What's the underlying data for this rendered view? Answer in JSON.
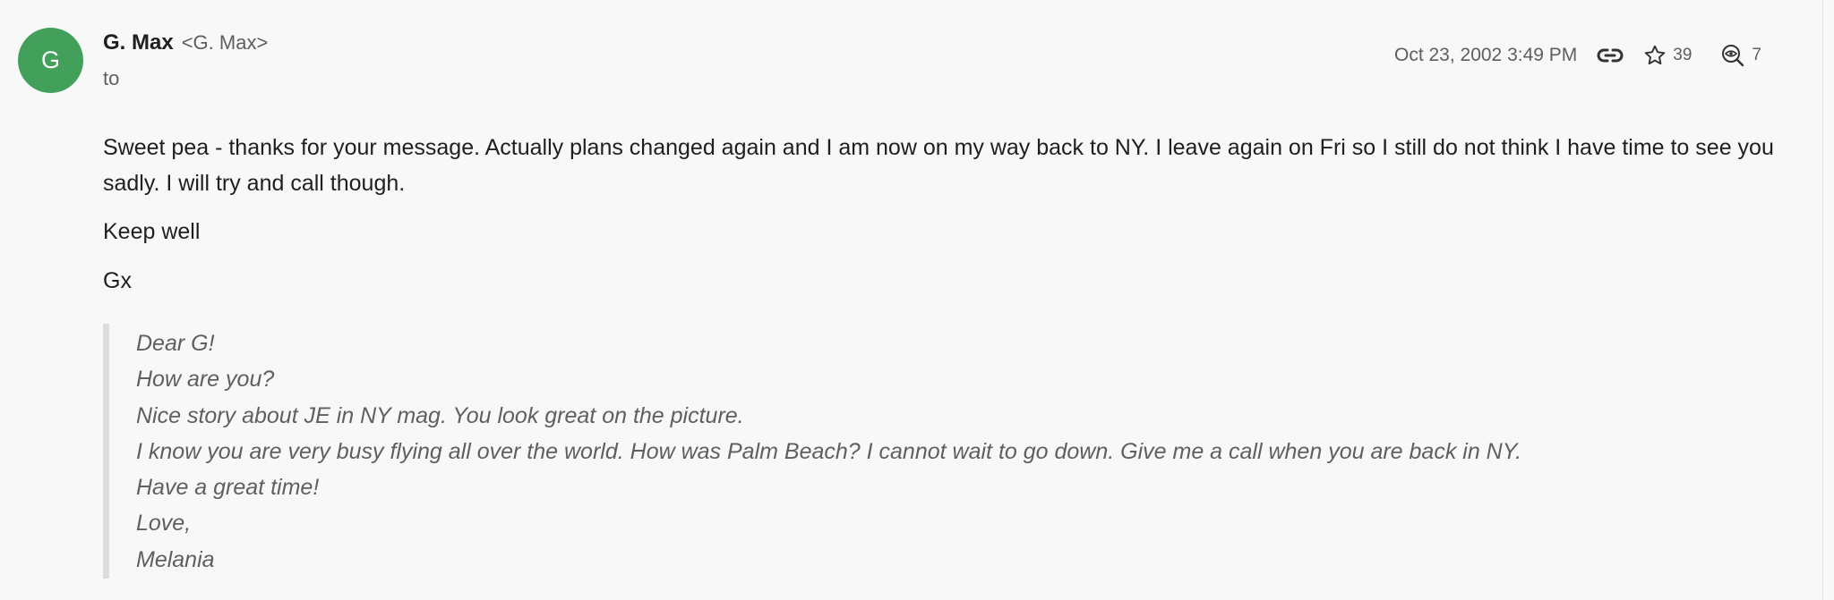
{
  "sender": {
    "avatar_letter": "G",
    "avatar_color": "#43a05a",
    "name": "G. Max",
    "email": "<G. Max>",
    "recipient_label": "to"
  },
  "meta": {
    "date": "Oct 23, 2002 3:49 PM",
    "star_count": "39",
    "view_count": "7",
    "icons": [
      "link-icon",
      "star-icon",
      "views-icon"
    ]
  },
  "body": {
    "paragraphs": [
      "Sweet pea - thanks for your message. Actually plans changed again and I am now on my way back to NY. I leave again on Fri so I still do not think I have time to see you sadly. I will try and call though.",
      "Keep well",
      "Gx"
    ]
  },
  "quoted": {
    "lines": [
      "Dear G!",
      "How are you?",
      "Nice story about JE in NY mag. You look great on the picture.",
      "I know you are very busy flying all over the world. How was Palm Beach? I cannot wait to go down. Give me a call when you are back in NY.",
      "Have a great time!",
      "Love,",
      "Melania"
    ]
  }
}
